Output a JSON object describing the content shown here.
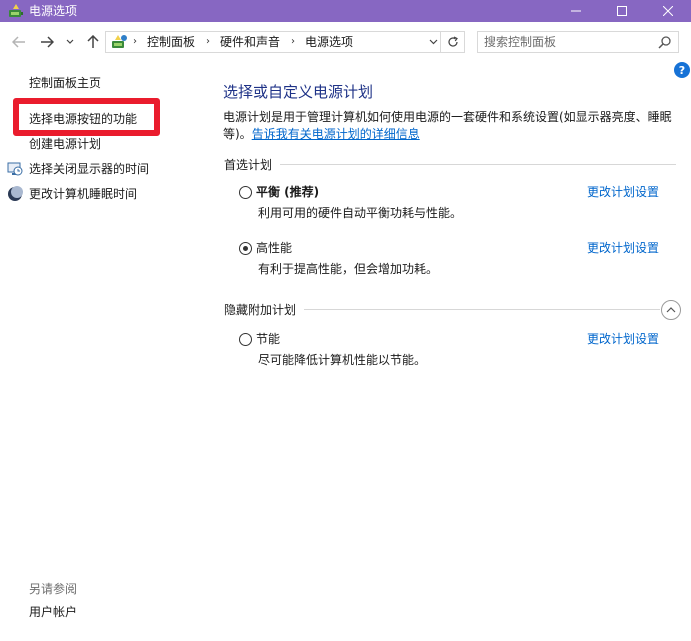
{
  "window": {
    "title": "电源选项",
    "icon": "power-options-icon"
  },
  "nav": {
    "back": "back-arrow-icon",
    "forward": "forward-arrow-icon",
    "recent": "chevron-down-icon",
    "up": "up-arrow-icon"
  },
  "address": {
    "breadcrumbs": [
      "控制面板",
      "硬件和声音",
      "电源选项"
    ],
    "separator": "›"
  },
  "search": {
    "placeholder": "搜索控制面板"
  },
  "left_pane": {
    "links": [
      {
        "label": "控制面板主页"
      },
      {
        "label": "选择电源按钮的功能"
      },
      {
        "label": "创建电源计划"
      },
      {
        "label": "选择关闭显示器的时间"
      },
      {
        "label": "更改计算机睡眠时间"
      }
    ],
    "see_also_label": "另请参阅",
    "see_also_links": [
      {
        "label": "用户帐户"
      }
    ],
    "highlight_color": "#ea1c2d"
  },
  "main": {
    "title": "选择或自定义电源计划",
    "description": "电源计划是用于管理计算机如何使用电源的一套硬件和系统设置(如显示器亮度、睡眠等)。",
    "description_link": "告诉我有关电源计划的详细信息",
    "preferred_header": "首选计划",
    "hidden_header": "隐藏附加计划",
    "plans": [
      {
        "name": "平衡 (推荐)",
        "description": "利用可用的硬件自动平衡功耗与性能。",
        "link": "更改计划设置",
        "selected": false
      },
      {
        "name": "高性能",
        "description": "有利于提高性能，但会增加功耗。",
        "link": "更改计划设置",
        "selected": true
      },
      {
        "name": "节能",
        "description": "尽可能降低计算机性能以节能。",
        "link": "更改计划设置",
        "selected": false
      }
    ]
  },
  "colors": {
    "titlebar": "#8767c2",
    "link": "#0066cc",
    "heading": "#1e3287"
  }
}
